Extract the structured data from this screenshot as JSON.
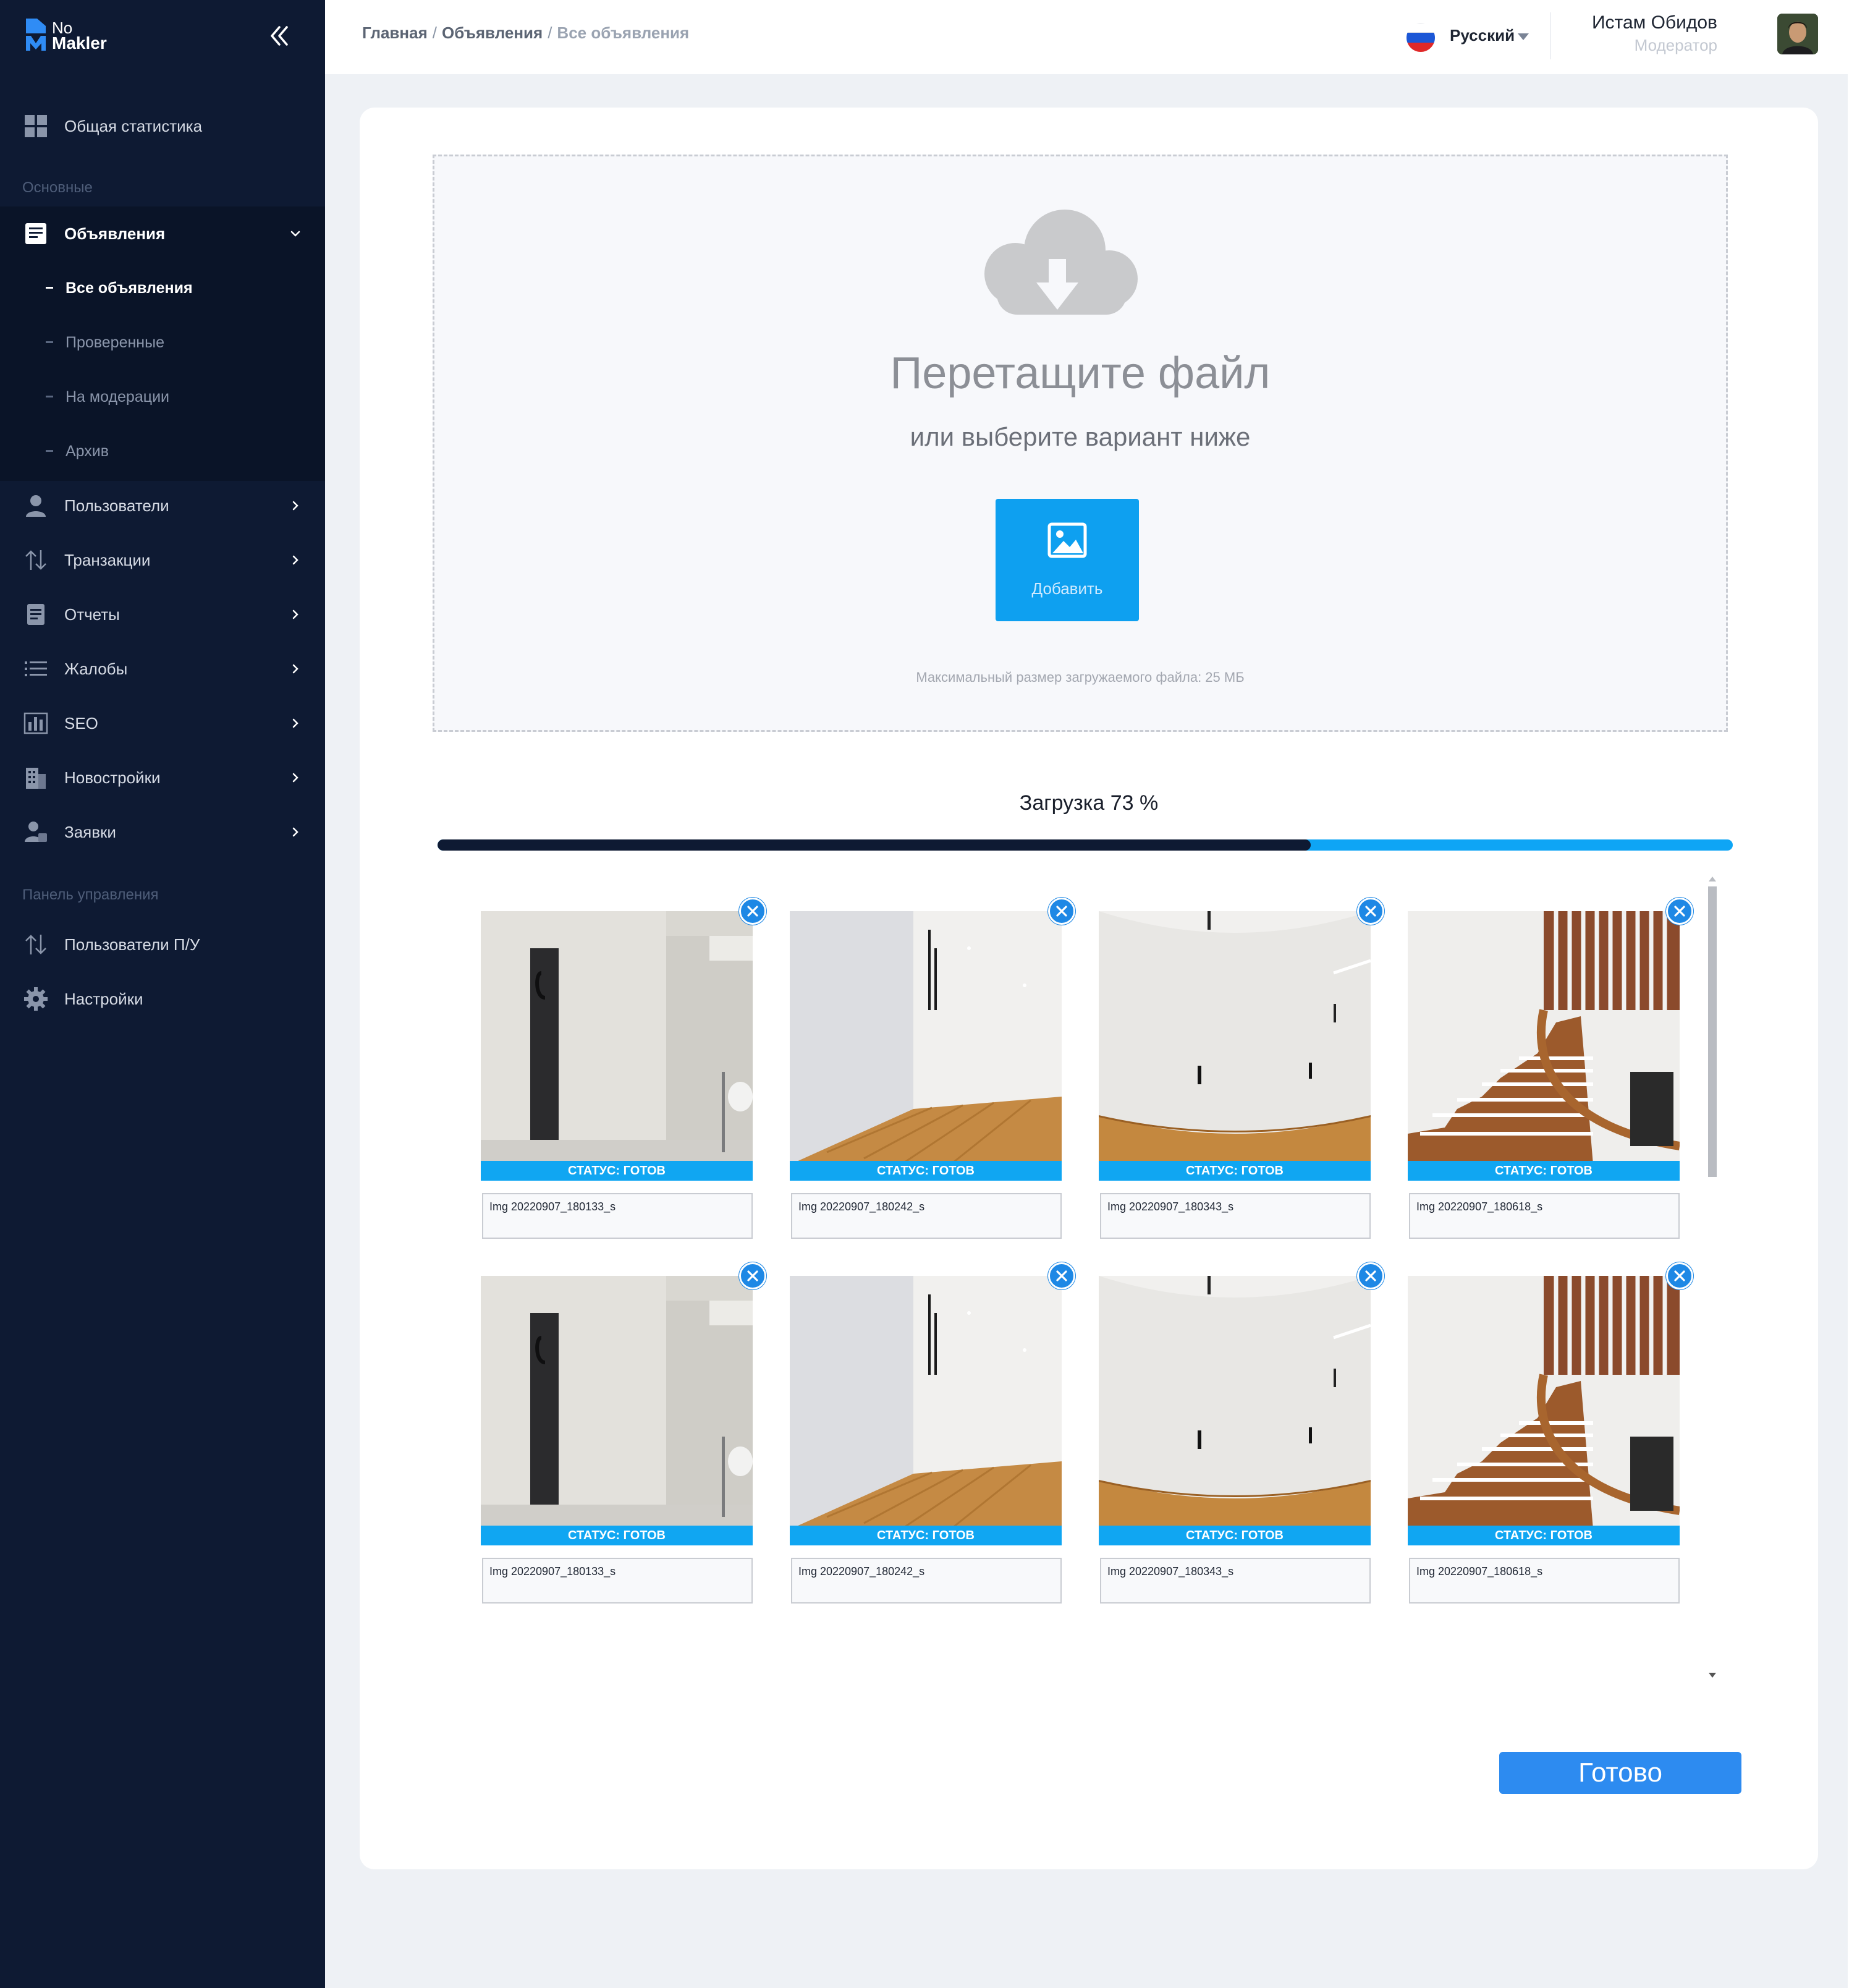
{
  "app": {
    "logo_line1": "No",
    "logo_line2": "Makler"
  },
  "sidebar": {
    "top_item": {
      "label": "Общая статистика",
      "icon": "dashboard-icon"
    },
    "section_main": "Основные",
    "ads": {
      "label": "Объявления",
      "icon": "ads-icon"
    },
    "ads_children": [
      {
        "label": "Все объявления",
        "active": true
      },
      {
        "label": "Проверенные",
        "active": false
      },
      {
        "label": "На модерации",
        "active": false
      },
      {
        "label": "Архив",
        "active": false
      }
    ],
    "items": [
      {
        "label": "Пользователи",
        "icon": "user-icon"
      },
      {
        "label": "Транзакции",
        "icon": "transactions-icon"
      },
      {
        "label": "Отчеты",
        "icon": "report-icon"
      },
      {
        "label": "Жалобы",
        "icon": "list-icon"
      },
      {
        "label": "SEO",
        "icon": "chart-bars-icon"
      },
      {
        "label": "Новостройки",
        "icon": "building-icon"
      },
      {
        "label": "Заявки",
        "icon": "user-request-icon"
      }
    ],
    "section_panel": "Панель управления",
    "panel_items": [
      {
        "label": "Пользователи П/У",
        "icon": "transactions-icon"
      },
      {
        "label": "Настройки",
        "icon": "gear-icon"
      }
    ]
  },
  "header": {
    "breadcrumb": [
      "Главная",
      "Объявления",
      "Все объявления"
    ],
    "language": "Русский",
    "user_name": "Истам Обидов",
    "user_role": "Модератор"
  },
  "upload": {
    "title": "Перетащите файл",
    "subtitle": "или выберите вариант ниже",
    "add_label": "Добавить",
    "note": "Максимальный размер загружаемого файла: 25 МБ",
    "progress_label": "Загрузка 73 %",
    "progress": 0.674
  },
  "images": [
    {
      "status": "СТАТУС: ГОТОВ",
      "name": "Img 20220907_180133_s"
    },
    {
      "status": "СТАТУС: ГОТОВ",
      "name": "Img 20220907_180242_s"
    },
    {
      "status": "СТАТУС: ГОТОВ",
      "name": "Img 20220907_180343_s"
    },
    {
      "status": "СТАТУС: ГОТОВ",
      "name": "Img 20220907_180618_s"
    },
    {
      "status": "СТАТУС: ГОТОВ",
      "name": "Img 20220907_180133_s"
    },
    {
      "status": "СТАТУС: ГОТОВ",
      "name": "Img 20220907_180242_s"
    },
    {
      "status": "СТАТУС: ГОТОВ",
      "name": "Img 20220907_180343_s"
    },
    {
      "status": "СТАТУС: ГОТОВ",
      "name": "Img 20220907_180618_s"
    }
  ],
  "actions": {
    "done_label": "Готово"
  },
  "colors": {
    "sidebar_bg": "#0e1a33",
    "accent": "#0ea0f0",
    "status_bar": "#10a6f2",
    "done_button": "#2d8bf0"
  }
}
